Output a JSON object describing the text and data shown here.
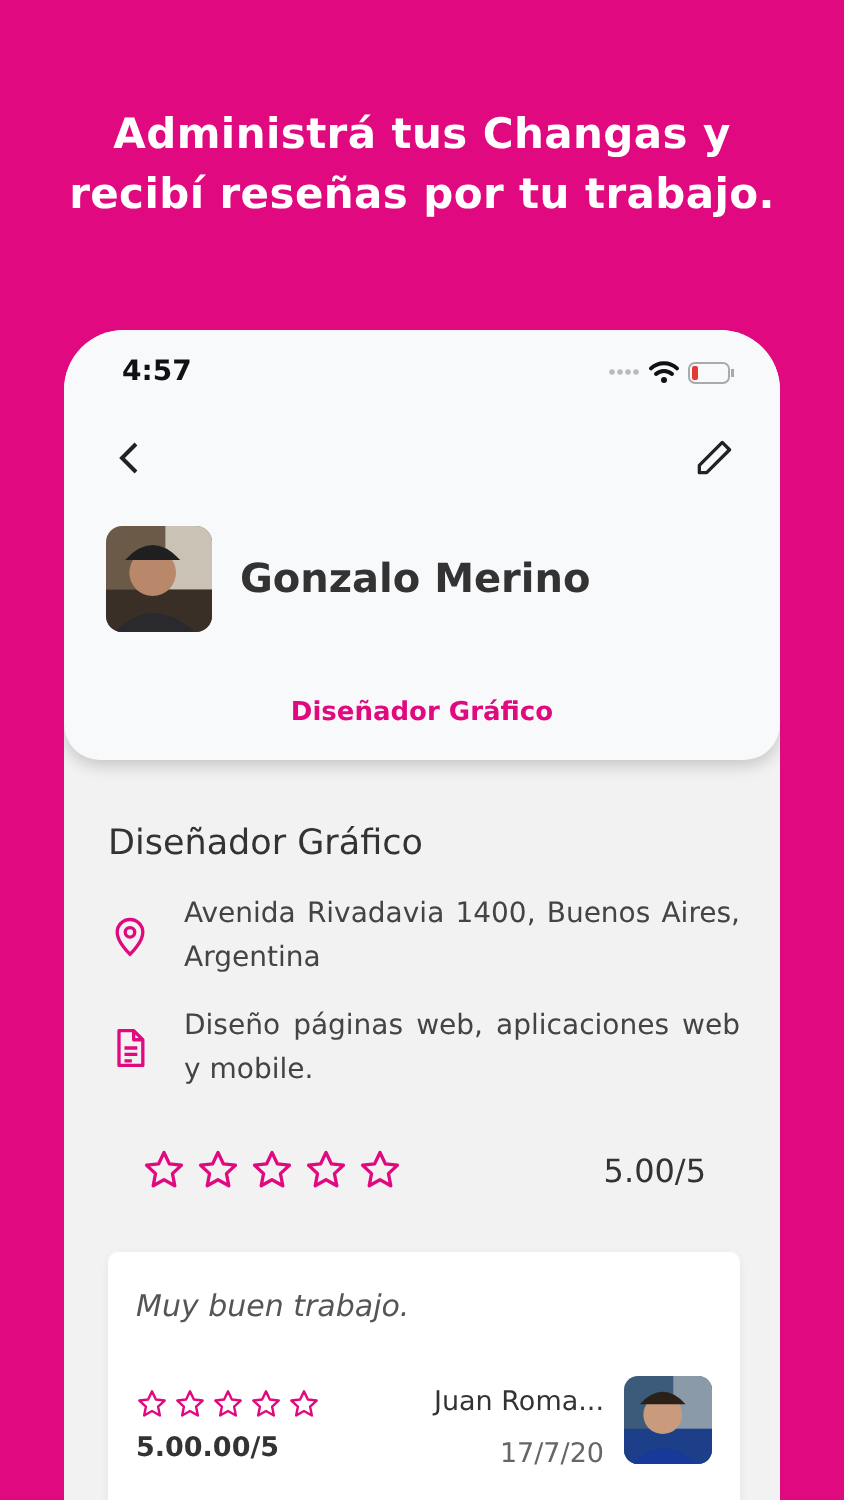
{
  "headline": "Administrá tus Changas y recibí reseñas por tu trabajo.",
  "status_bar": {
    "time": "4:57"
  },
  "profile": {
    "name": "Gonzalo Merino",
    "role_tab": "Diseñador Gráfico"
  },
  "details": {
    "title": "Diseñador Gráfico",
    "rows": [
      {
        "kind": "location",
        "text": "Avenida Rivadavia 1400, Buenos Aires, Argentina"
      },
      {
        "kind": "document",
        "text": "Diseño páginas web, aplicaciones web y mobile."
      }
    ],
    "stars": 0,
    "rating": "5.00/5"
  },
  "reviews": [
    {
      "comment": "Muy buen trabajo.",
      "stars": 0,
      "rating": "5.00.00/5",
      "author": "Juan Roma...",
      "date": "17/7/20"
    }
  ]
}
